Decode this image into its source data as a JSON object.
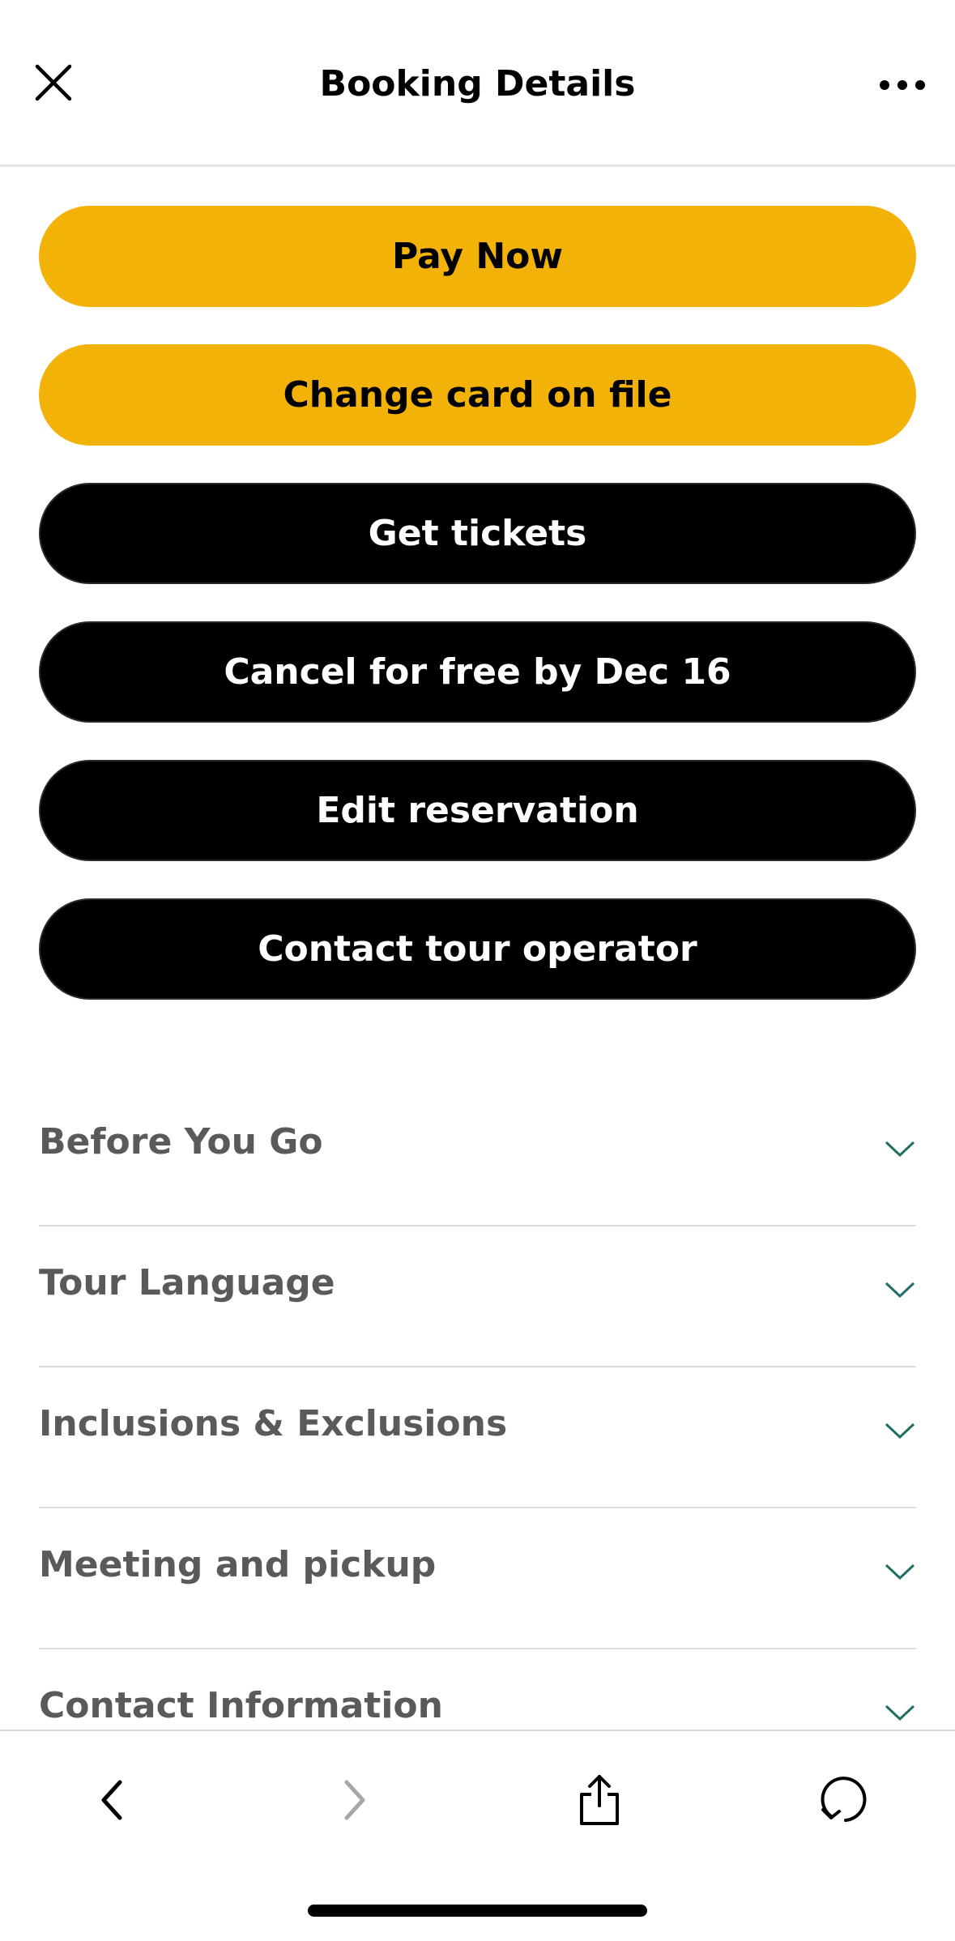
{
  "header": {
    "title": "Booking Details",
    "close_icon": "close-icon",
    "more_icon": "more-horizontal-icon"
  },
  "actions": [
    {
      "label": "Pay Now",
      "style": "yellow"
    },
    {
      "label": "Change card on file",
      "style": "yellow"
    },
    {
      "label": "Get tickets",
      "style": "black"
    },
    {
      "label": "Cancel for free by Dec 16",
      "style": "black"
    },
    {
      "label": "Edit reservation",
      "style": "black"
    },
    {
      "label": "Contact tour operator",
      "style": "black"
    }
  ],
  "sections": [
    {
      "label": "Before You Go"
    },
    {
      "label": "Tour Language"
    },
    {
      "label": "Inclusions & Exclusions"
    },
    {
      "label": "Meeting and pickup"
    },
    {
      "label": "Contact Information"
    }
  ],
  "toolbar": {
    "back_icon": "chevron-left-icon",
    "forward_icon": "chevron-right-icon",
    "share_icon": "share-icon",
    "refresh_icon": "refresh-icon"
  },
  "colors": {
    "accent_yellow": "#f2b207",
    "primary_black": "#000000",
    "chevron_teal": "#1f6e63",
    "section_text": "#5a5a5a"
  }
}
